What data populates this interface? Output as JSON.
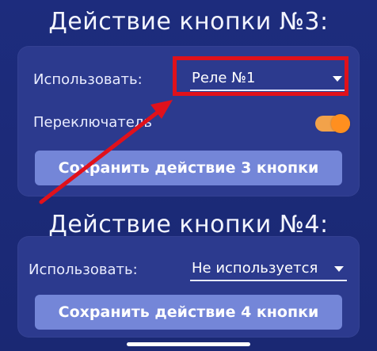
{
  "sections": [
    {
      "title": "Действие кнопки №3:",
      "use_label": "Использовать:",
      "use_value": "Реле №1",
      "toggle_label": "Переключатель",
      "toggle_on": true,
      "save_label": "Сохранить действие 3 кнопки"
    },
    {
      "title": "Действие кнопки №4:",
      "use_label": "Использовать:",
      "use_value": "Не используется",
      "save_label": "Сохранить действие 4 кнопки"
    }
  ],
  "colors": {
    "background": "#1b2a78",
    "card": "#2c3a8e",
    "button": "#7486d8",
    "toggle_on": "#ff8f1f",
    "highlight": "#e0111b"
  },
  "icons": {
    "dropdown": "caret-down-icon",
    "annotation": "red-arrow-icon"
  }
}
